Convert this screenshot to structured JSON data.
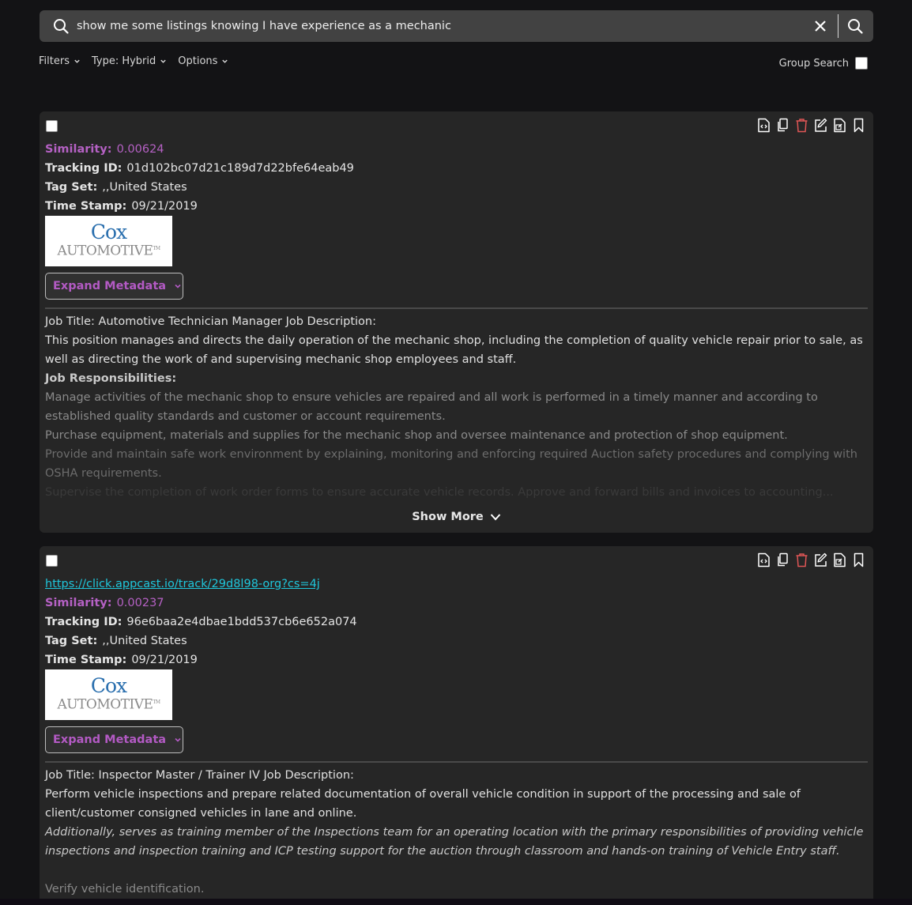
{
  "search": {
    "query": "show me some listings knowing I have experience as a mechanic",
    "search_icon": "search-icon",
    "clear_icon": "close-icon",
    "submit_icon": "search-icon"
  },
  "toolbar": {
    "filters_label": "Filters",
    "type_label": "Type: Hybrid",
    "options_label": "Options",
    "group_search_label": "Group Search",
    "group_search_checked": false
  },
  "colors": {
    "background": "#131315",
    "card": "#262626",
    "accent_purple": "#b561c4",
    "link_cyan": "#1fc7dc",
    "delete_red": "#e05656"
  },
  "card_actions": [
    {
      "name": "view-source",
      "icon": "file-code-icon"
    },
    {
      "name": "copy",
      "icon": "copy-icon"
    },
    {
      "name": "delete",
      "icon": "trash-icon"
    },
    {
      "name": "edit",
      "icon": "edit-icon"
    },
    {
      "name": "open-external",
      "icon": "file-export-icon"
    },
    {
      "name": "bookmark",
      "icon": "bookmark-icon"
    }
  ],
  "results": [
    {
      "link": null,
      "similarity_label": "Similarity:",
      "similarity": "0.00624",
      "tracking_label": "Tracking ID:",
      "tracking_id": "01d102bc07d21c189d7d22bfe64eab49",
      "tagset_label": "Tag Set:",
      "tagset": ",,United States",
      "timestamp_label": "Time Stamp:",
      "timestamp": "09/21/2019",
      "logo": {
        "line1": "Cox",
        "line2": "Automotive",
        "tm": "TM"
      },
      "expand_label": "Expand Metadata",
      "description": {
        "title_line": "Job Title: Automotive Technician Manager Job Description:",
        "intro": "This position manages and directs the daily operation of the mechanic shop, including the completion of quality vehicle repair prior to sale, as well as directing the work of and supervising mechanic shop employees and staff.",
        "responsibilities_heading": "Job Responsibilities:",
        "items": [
          "Manage activities of the mechanic shop to ensure vehicles are repaired and all work is performed in a timely manner and according to established quality standards and customer or account requirements.",
          "Purchase equipment, materials and supplies for the mechanic shop and oversee maintenance and protection of shop equipment.",
          "Provide and maintain safe work environment by explaining, monitoring and enforcing required Auction safety procedures and complying with OSHA requirements.",
          "Supervise the completion of work order forms to ensure accurate vehicle records. Approve and forward bills and invoices to accounting..."
        ]
      },
      "show_more_label": "Show More"
    },
    {
      "link": "https://click.appcast.io/track/29d8l98-org?cs=4j",
      "similarity_label": "Similarity:",
      "similarity": "0.00237",
      "tracking_label": "Tracking ID:",
      "tracking_id": "96e6baa2e4dbae1bdd537cb6e652a074",
      "tagset_label": "Tag Set:",
      "tagset": ",,United States",
      "timestamp_label": "Time Stamp:",
      "timestamp": "09/21/2019",
      "logo": {
        "line1": "Cox",
        "line2": "Automotive",
        "tm": "TM"
      },
      "expand_label": "Expand Metadata",
      "description": {
        "title_line": "Job Title: Inspector Master / Trainer IV Job Description:",
        "intro": "Perform vehicle inspections and prepare related documentation of overall vehicle condition in support of the processing and sale of client/customer consigned vehicles in lane and online.",
        "italic": "Additionally, serves as training member of the Inspections team for an operating location with the primary responsibilities of providing vehicle inspections and inspection training and ICP testing support for the auction through classroom and hands-on training of Vehicle Entry staff.",
        "items": [
          "Verify vehicle identification."
        ]
      }
    }
  ]
}
